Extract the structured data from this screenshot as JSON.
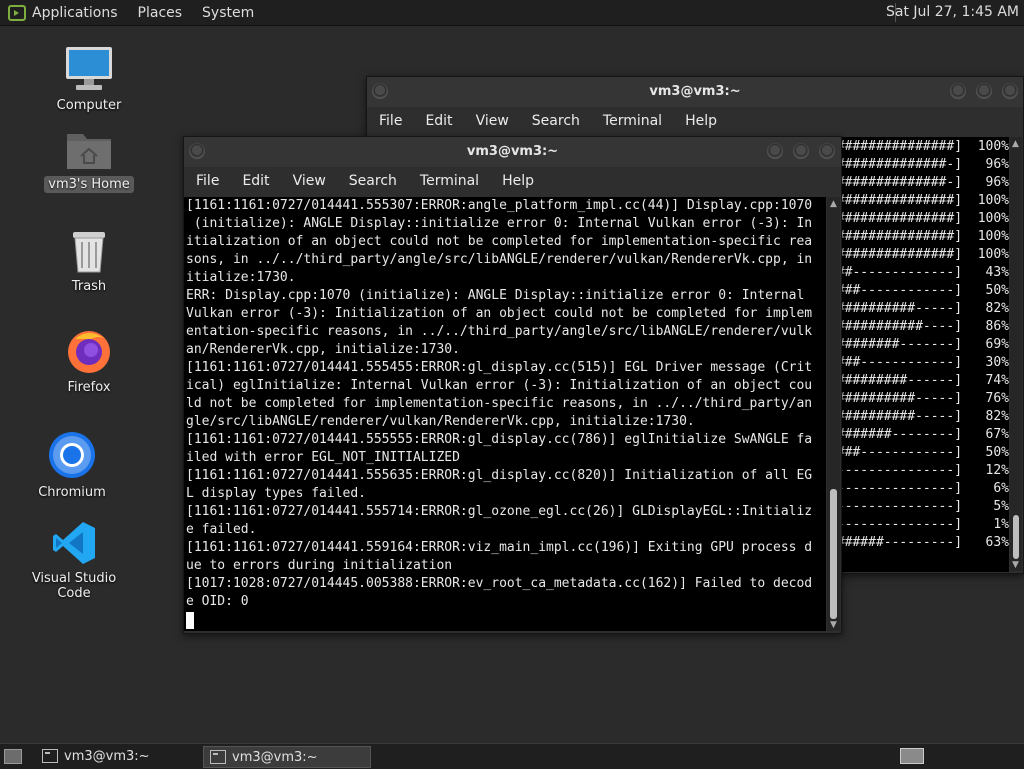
{
  "top_panel": {
    "menus": [
      "Applications",
      "Places",
      "System"
    ],
    "clock": "Sat Jul 27,  1:45 AM"
  },
  "desktop": {
    "icons": [
      {
        "label": "Computer",
        "icon": "computer-icon"
      },
      {
        "label": "vm3's Home",
        "icon": "home-folder-icon"
      },
      {
        "label": "Trash",
        "icon": "trash-icon"
      },
      {
        "label": "Firefox",
        "icon": "firefox-icon"
      },
      {
        "label": "Chromium",
        "icon": "chromium-icon"
      },
      {
        "label": "Visual Studio Code",
        "icon": "vscode-icon"
      }
    ]
  },
  "back_window": {
    "title": "vm3@vm3:~",
    "menu": [
      "File",
      "Edit",
      "View",
      "Search",
      "Terminal",
      "Help"
    ],
    "lines": [
      "###############]  100%",
      "##############-]   96%",
      "##############-]   96%",
      "###############]  100%",
      "###############]  100%",
      "###############]  100%",
      "###############]  100%",
      "##-------------]   43%",
      "###------------]   50%",
      "##########-----]   82%",
      "###########----]   86%",
      "########-------]   69%",
      "###------------]   30%",
      "#########------]   74%",
      "##########-----]   76%",
      "##########-----]   82%",
      "#######--------]   67%",
      "###------------]   50%",
      "---------------]   12%",
      "---------------]    6%",
      "---------------]    5%",
      "---------------]    1%",
      "######---------]   63%"
    ]
  },
  "front_window": {
    "title": "vm3@vm3:~",
    "menu": [
      "File",
      "Edit",
      "View",
      "Search",
      "Terminal",
      "Help"
    ],
    "lines": [
      "[1161:1161:0727/014441.555307:ERROR:angle_platform_impl.cc(44)] Display.cpp:1070",
      " (initialize): ANGLE Display::initialize error 0: Internal Vulkan error (-3): In",
      "itialization of an object could not be completed for implementation-specific rea",
      "sons, in ../../third_party/angle/src/libANGLE/renderer/vulkan/RendererVk.cpp, in",
      "itialize:1730.",
      "ERR: Display.cpp:1070 (initialize): ANGLE Display::initialize error 0: Internal",
      "Vulkan error (-3): Initialization of an object could not be completed for implem",
      "entation-specific reasons, in ../../third_party/angle/src/libANGLE/renderer/vulk",
      "an/RendererVk.cpp, initialize:1730.",
      "[1161:1161:0727/014441.555455:ERROR:gl_display.cc(515)] EGL Driver message (Crit",
      "ical) eglInitialize: Internal Vulkan error (-3): Initialization of an object cou",
      "ld not be completed for implementation-specific reasons, in ../../third_party/an",
      "gle/src/libANGLE/renderer/vulkan/RendererVk.cpp, initialize:1730.",
      "[1161:1161:0727/014441.555555:ERROR:gl_display.cc(786)] eglInitialize SwANGLE fa",
      "iled with error EGL_NOT_INITIALIZED",
      "[1161:1161:0727/014441.555635:ERROR:gl_display.cc(820)] Initialization of all EG",
      "L display types failed.",
      "[1161:1161:0727/014441.555714:ERROR:gl_ozone_egl.cc(26)] GLDisplayEGL::Initializ",
      "e failed.",
      "[1161:1161:0727/014441.559164:ERROR:viz_main_impl.cc(196)] Exiting GPU process d",
      "ue to errors during initialization",
      "[1017:1028:0727/014445.005388:ERROR:ev_root_ca_metadata.cc(162)] Failed to decod",
      "e OID: 0"
    ]
  },
  "taskbar": {
    "tasks": [
      {
        "label": "vm3@vm3:~",
        "active": false
      },
      {
        "label": "vm3@vm3:~",
        "active": true
      }
    ]
  }
}
